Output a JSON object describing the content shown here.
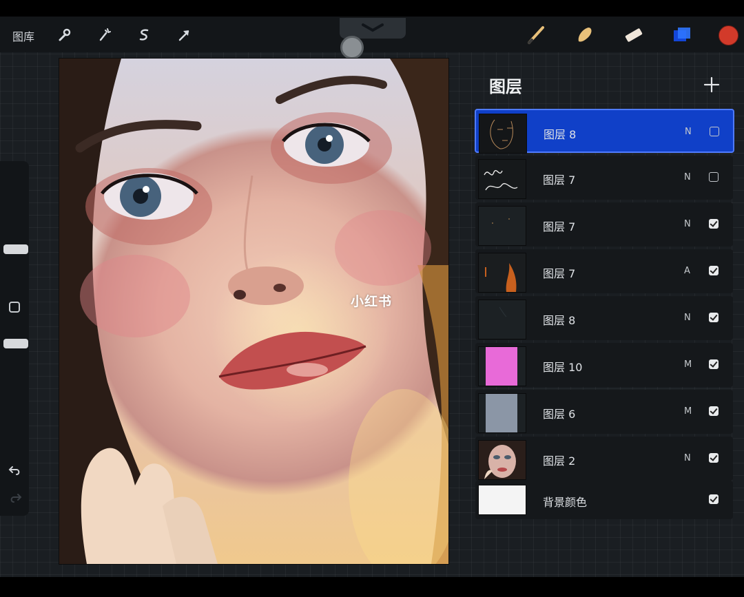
{
  "toolbar": {
    "gallery_label": "图库",
    "left_tools": [
      "wrench-icon",
      "magic-wand-icon",
      "selection-icon",
      "transform-arrow-icon"
    ],
    "right_tools": [
      "brush-icon",
      "smudge-icon",
      "eraser-icon",
      "layers-icon"
    ],
    "current_color": "#d23a2a"
  },
  "canvas": {
    "watermark": "小红书"
  },
  "layers_panel": {
    "title": "图层",
    "layers": [
      {
        "name": "图层 8",
        "mode": "N",
        "visible": false,
        "active": true,
        "thumb": "sketch"
      },
      {
        "name": "图层 7",
        "mode": "N",
        "visible": false,
        "active": false,
        "thumb": "signature"
      },
      {
        "name": "图层 7",
        "mode": "N",
        "visible": true,
        "active": false,
        "thumb": "dark"
      },
      {
        "name": "图层 7",
        "mode": "A",
        "visible": true,
        "active": false,
        "thumb": "fire"
      },
      {
        "name": "图层 8",
        "mode": "N",
        "visible": true,
        "active": false,
        "thumb": "dark"
      },
      {
        "name": "图层 10",
        "mode": "M",
        "visible": true,
        "active": false,
        "thumb": "pink"
      },
      {
        "name": "图层 6",
        "mode": "M",
        "visible": true,
        "active": false,
        "thumb": "gray"
      },
      {
        "name": "图层 2",
        "mode": "N",
        "visible": true,
        "active": false,
        "thumb": "portrait"
      },
      {
        "name": "背景颜色",
        "mode": "",
        "visible": true,
        "active": false,
        "thumb": "white"
      }
    ]
  },
  "colors": {
    "active_layer": "#1040c8",
    "pink_fill": "#e86ad8",
    "gray_fill": "#8b96a6"
  }
}
